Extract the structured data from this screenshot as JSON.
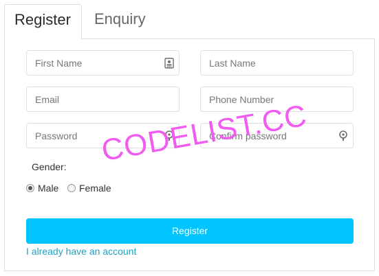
{
  "tabs": [
    {
      "label": "Register",
      "active": true
    },
    {
      "label": "Enquiry",
      "active": false
    }
  ],
  "form": {
    "first_name_placeholder": "First Name",
    "last_name_placeholder": "Last Name",
    "email_placeholder": "Email",
    "phone_placeholder": "Phone Number",
    "password_placeholder": "Password",
    "confirm_password_placeholder": "Confirm password",
    "first_name_icon": "id-card-icon",
    "password_icon": "key-icon",
    "confirm_password_icon": "key-icon",
    "gender_label": "Gender:",
    "gender_options": [
      {
        "label": "Male",
        "selected": true
      },
      {
        "label": "Female",
        "selected": false
      }
    ],
    "submit_label": "Register",
    "account_link": "I already have an account"
  },
  "watermark": "CODELIST.CC",
  "colors": {
    "accent": "#00c4ff",
    "link": "#1aa3c4",
    "watermark": "#f05cf0",
    "border": "#d9dde2"
  }
}
